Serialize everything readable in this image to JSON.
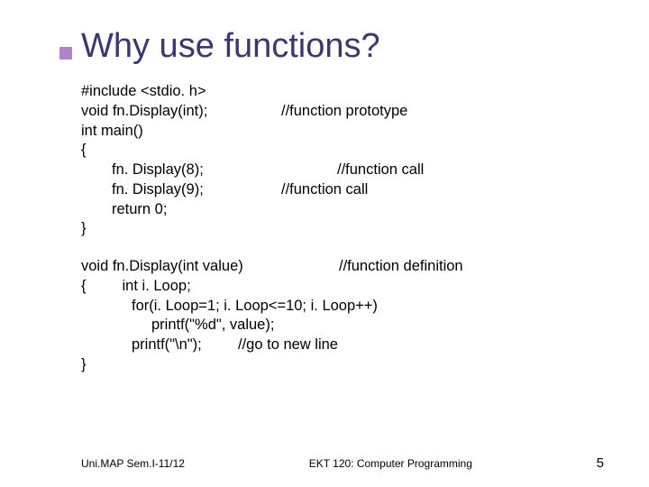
{
  "title": "Why use functions?",
  "code": {
    "l1": "#include <stdio. h>",
    "l2_left": "void fn.Display(int);",
    "l2_right": "//function prototype",
    "l3": "int main()",
    "l4": "{",
    "l5_left": "fn. Display(8);",
    "l5_right": "//function call",
    "l6_left": "fn. Display(9);",
    "l6_right": "//function call",
    "l7": "return 0;",
    "l8": "}",
    "l9_left": "void fn.Display(int value)",
    "l9_right": "//function definition",
    "l10": "{",
    "l10b": "int i. Loop;",
    "l11": "for(i. Loop=1; i. Loop<=10; i. Loop++)",
    "l12": "printf(\"%d\", value);",
    "l13_left": "printf(\"\\n\");",
    "l13_right": "//go to new line",
    "l14": "}"
  },
  "footer": {
    "left": "Uni.MAP Sem.I-11/12",
    "center": "EKT 120: Computer Programming",
    "pagenum": "5"
  }
}
